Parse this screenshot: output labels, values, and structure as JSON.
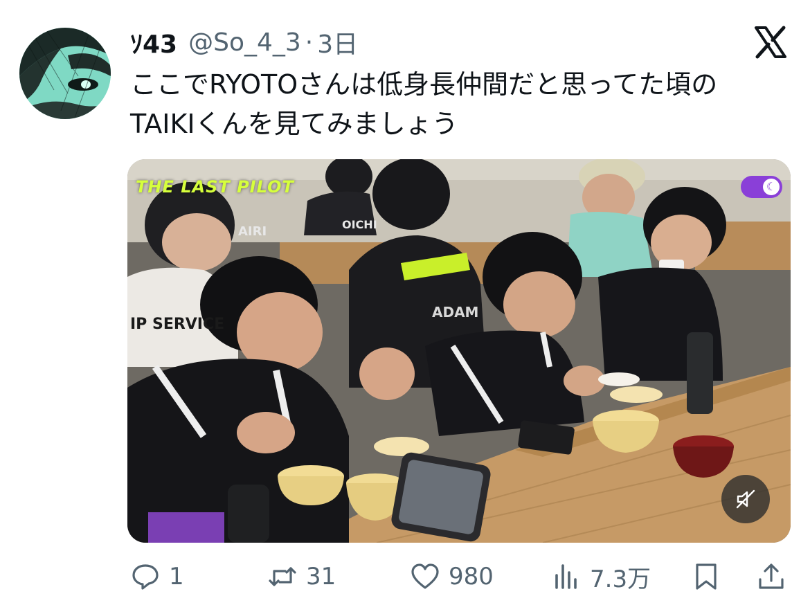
{
  "author": {
    "display_name": "ｿ43",
    "handle": "@So_4_3",
    "separator": "·",
    "time": "3日"
  },
  "tweet": {
    "text_lines": [
      "ここでRYOTOさんは低身長仲間だと思ってた頃の",
      "TAIKIくんを見てみましょう"
    ]
  },
  "media": {
    "overlay_brand": "THE LAST PILOT",
    "shirt_text_1": "IP SERVICE",
    "shirt_text_2": "AIRI",
    "shirt_text_3": "OICHI",
    "shirt_text_4": "ADAM",
    "toggle_icon": "moon-icon",
    "mute_icon": "speaker-muted-icon"
  },
  "actions": {
    "reply": {
      "icon": "reply-icon",
      "count": "1"
    },
    "retweet": {
      "icon": "retweet-icon",
      "count": "31"
    },
    "like": {
      "icon": "heart-icon",
      "count": "980"
    },
    "views": {
      "icon": "views-icon",
      "count": "7.3万"
    },
    "bookmark": {
      "icon": "bookmark-icon"
    },
    "share": {
      "icon": "share-icon"
    }
  },
  "colors": {
    "text_primary": "#0f1419",
    "text_secondary": "#536471",
    "toggle_purple": "#8a3fd8",
    "overlay_lime": "#d6ff3c"
  }
}
